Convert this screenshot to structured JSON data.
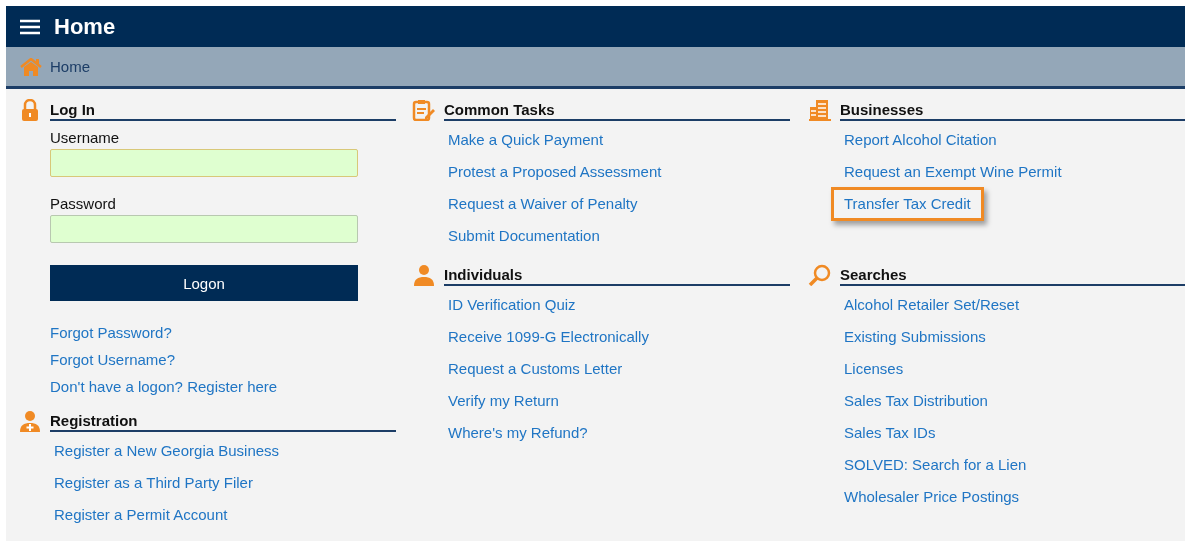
{
  "header": {
    "title": "Home"
  },
  "breadcrumb": {
    "label": "Home"
  },
  "login": {
    "title": "Log In",
    "kind": "lock",
    "fields": [
      {
        "label": "Username",
        "focused": true
      },
      {
        "label": "Password",
        "focused": false
      }
    ],
    "button": "Logon",
    "links": [
      {
        "label": "Forgot Password?",
        "highlighted": false
      },
      {
        "label": "Forgot Username?",
        "highlighted": false
      },
      {
        "label": "Don't have a logon? Register here",
        "highlighted": false
      }
    ]
  },
  "registration": {
    "title": "Registration",
    "kind": "person-add",
    "links": [
      {
        "label": "Register a New Georgia Business",
        "highlighted": false
      },
      {
        "label": "Register as a Third Party Filer",
        "highlighted": false
      },
      {
        "label": "Register a Permit Account",
        "highlighted": false
      }
    ]
  },
  "sections": [
    {
      "title": "Common Tasks",
      "kind": "clipboard",
      "links": [
        {
          "label": "Make a Quick Payment",
          "highlighted": false
        },
        {
          "label": "Protest a Proposed Assessment",
          "highlighted": false
        },
        {
          "label": "Request a Waiver of Penalty",
          "highlighted": false
        },
        {
          "label": "Submit Documentation",
          "highlighted": false
        }
      ]
    },
    {
      "title": "Businesses",
      "kind": "building",
      "links": [
        {
          "label": "Report Alcohol Citation",
          "highlighted": false
        },
        {
          "label": "Request an Exempt Wine Permit",
          "highlighted": false
        },
        {
          "label": "Transfer Tax Credit",
          "highlighted": true
        }
      ]
    },
    {
      "title": "Individuals",
      "kind": "person",
      "links": [
        {
          "label": "ID Verification Quiz",
          "highlighted": false
        },
        {
          "label": "Receive 1099-G Electronically",
          "highlighted": false
        },
        {
          "label": "Request a Customs Letter",
          "highlighted": false
        },
        {
          "label": "Verify my Return",
          "highlighted": false
        },
        {
          "label": "Where's my Refund?",
          "highlighted": false
        }
      ]
    },
    {
      "title": "Searches",
      "kind": "search",
      "links": [
        {
          "label": "Alcohol Retailer Set/Reset",
          "highlighted": false
        },
        {
          "label": "Existing Submissions",
          "highlighted": false
        },
        {
          "label": "Licenses",
          "highlighted": false
        },
        {
          "label": "Sales Tax Distribution",
          "highlighted": false
        },
        {
          "label": "Sales Tax IDs",
          "highlighted": false
        },
        {
          "label": "SOLVED: Search for a Lien",
          "highlighted": false
        },
        {
          "label": "Wholesaler Price Postings",
          "highlighted": false
        }
      ]
    }
  ]
}
